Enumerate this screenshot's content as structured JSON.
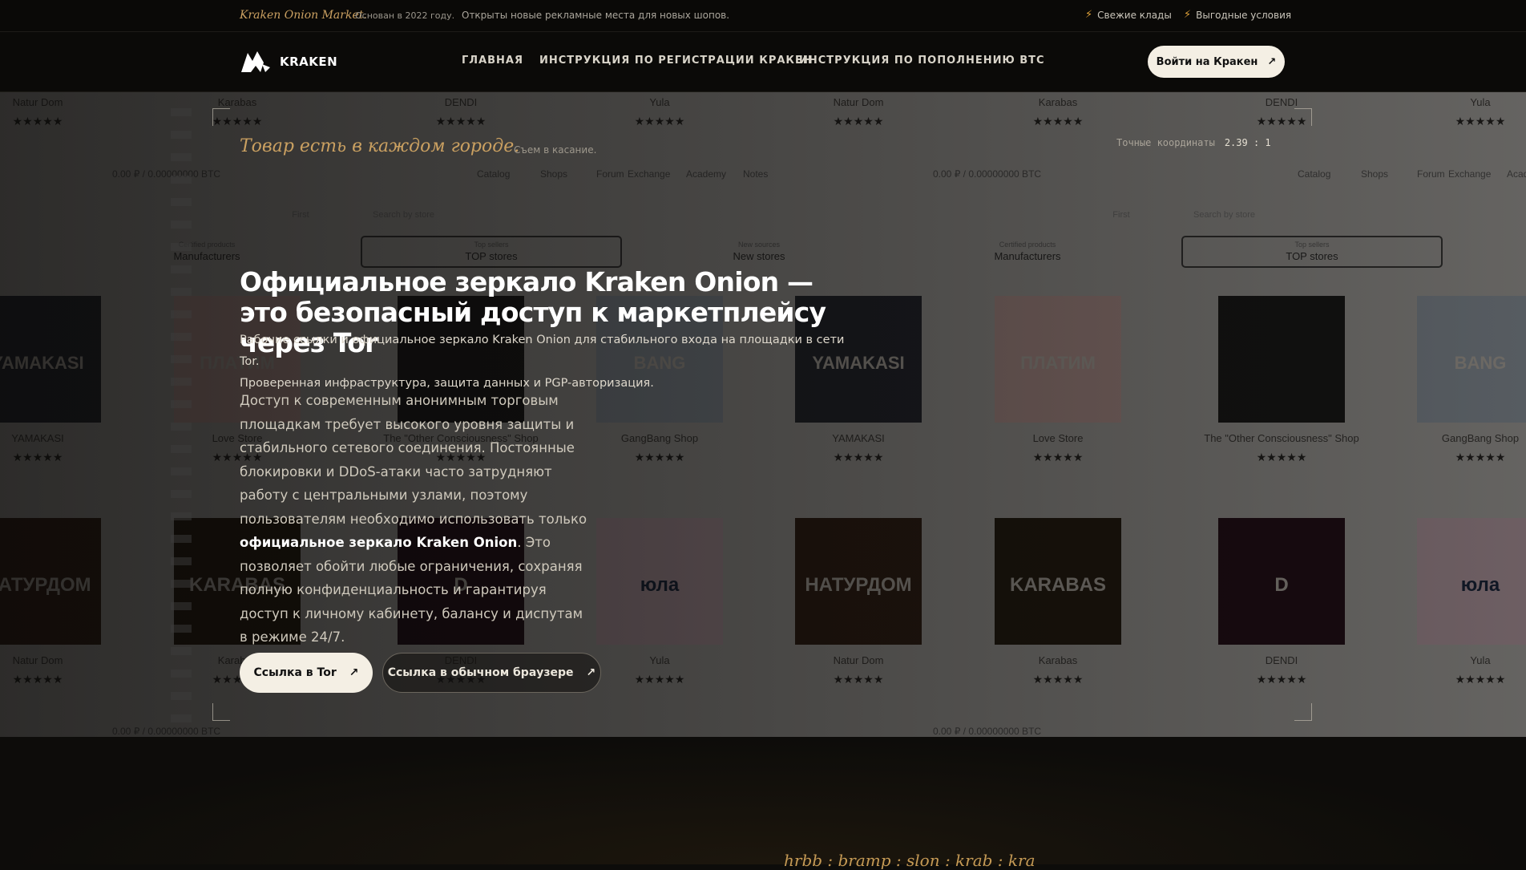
{
  "topbar": {
    "brand": "Kraken Onion Market.",
    "founded": "Основан в 2022 году.",
    "promo": "Открыты новые рекламные места для новых шопов.",
    "tags": [
      "Свежие клады",
      "Выгодные условия"
    ]
  },
  "nav": {
    "logo_text": "KRAKEN",
    "links": [
      "ГЛАВНАЯ",
      "ИНСТРУКЦИЯ ПО РЕГИСТРАЦИИ КРАКЕН",
      "ИНСТРУКЦИЯ ПО ПОПОЛНЕНИЮ BTC"
    ],
    "login_label": "Войти на Кракен"
  },
  "hero": {
    "tagline": "Товар есть в каждом городе.",
    "tagline_sub": "Съем в касание.",
    "coords_label": "Точные координаты",
    "coords_value": "2.39 : 1",
    "title": "Официальное зеркало Kraken Onion — это безопасный доступ к маркетплейсу через Tor",
    "lead_line1": "Рабочие ссылки и официальное зеркало Kraken Onion для стабильного входа на площадки в сети Tor.",
    "lead_line2": "Проверенная инфраструктура, защита данных и PGP-авторизация.",
    "body_part1": "Доступ к современным анонимным торговым площадкам требует высокого уровня защиты и стабильного сетевого соединения. Постоянные блокировки и DDoS-атаки часто затрудняют работу с центральными узлами, поэтому пользователям необходимо использовать только ",
    "body_strong": "официальное зеркало Kraken Onion",
    "body_part2": ". Это позволяет обойти любые ограничения, сохраняя полную конфиденциальность и гарантируя доступ к личному кабинету, балансу и диспутам в режиме 24/7.",
    "btn_tor": "Ссылка в Tor",
    "btn_browser": "Ссылка в обычном браузере"
  },
  "background_screenshot": {
    "balance": "0.00 ₽ / 0.00000000 BTC",
    "menu": [
      "Catalog",
      "Shops",
      "Forum",
      "Exchange",
      "Academy",
      "Notes"
    ],
    "tabs": [
      {
        "small": "Top sellers",
        "big": "TOP stores"
      },
      {
        "small": "New sources",
        "big": "New stores"
      },
      {
        "small": "Certified products",
        "big": "Manufacturers"
      }
    ],
    "filter_first": "First",
    "search_placeholder": "Search by store",
    "row_top_shops": [
      "Natur Dom",
      "Karabas",
      "DENDI",
      "Yula",
      "Natur Dom",
      "Karabas",
      "DENDI",
      "Yula"
    ],
    "row_mid_shops": [
      "YAMAKASI",
      "Love Store",
      "The \"Other Consciousness\" Shop",
      "GangBang Shop",
      "YAMAKASI",
      "Love Store",
      "The \"Other Consciousness\" Shop",
      "GangBang Shop"
    ],
    "row_bottom_shops": [
      "Natur Dom",
      "Karabas",
      "DENDI",
      "Yula",
      "Natur Dom",
      "Karabas",
      "DENDI",
      "Yula"
    ],
    "stars": "★★★★★",
    "tile_labels": [
      "YAMAKASI",
      "ПЛАТИМ",
      "BANG",
      "НАТУРДОМ",
      "KARABAS",
      "D",
      "юла"
    ]
  },
  "bottom": {
    "marquee": "hrbb : bramp : slon : krab : kra"
  },
  "colors": {
    "accent_gold": "#caa061",
    "button_light": "#f4efe4",
    "bolt": "#e0a23a"
  }
}
